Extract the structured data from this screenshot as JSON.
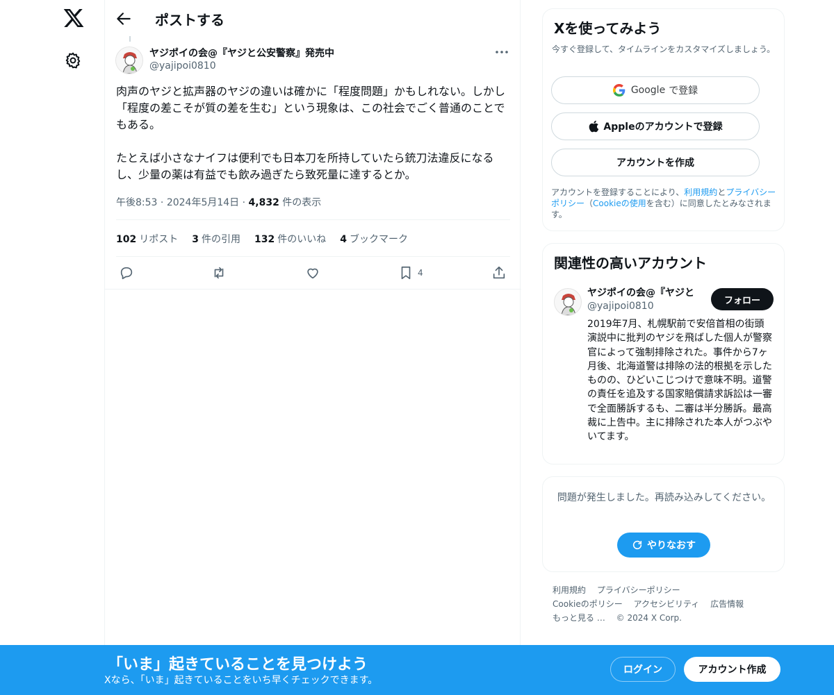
{
  "header": {
    "title": "ポストする"
  },
  "post": {
    "author_name": "ヤジポイの会@『ヤジと公安警察』発売中",
    "author_handle": "@yajipoi0810",
    "text": "肉声のヤジと拡声器のヤジの違いは確かに「程度問題」かもしれない。しかし「程度の差こそが質の差を生む」という現象は、この社会でごく普通のことでもある。\n\nたとえば小さなナイフは便利でも日本刀を所持していたら銃刀法違反になるし、少量の薬は有益でも飲み過ぎたら致死量に達するとか。",
    "time": "午後8:53",
    "date": "2024年5月14日",
    "views_count": "4,832",
    "views_label": "件の表示",
    "stats": {
      "reposts_count": "102",
      "reposts_label": "リポスト",
      "quotes_count": "3",
      "quotes_label": "件の引用",
      "likes_count": "132",
      "likes_label": "件のいいね",
      "bookmarks_count": "4",
      "bookmarks_label": "ブックマーク"
    },
    "bookmark_action_count": "4"
  },
  "signup_card": {
    "title": "Xを使ってみよう",
    "description": "今すぐ登録して、タイムラインをカスタマイズしましょう。",
    "google_brand": "Google",
    "google_suffix": "で登録",
    "apple_label": "Appleのアカウントで登録",
    "create_label": "アカウントを作成",
    "legal_prefix": "アカウントを登録することにより、",
    "legal_terms": "利用規約",
    "legal_and": "と",
    "legal_privacy": "プライバシーポリシー",
    "legal_paren_open": "（",
    "legal_cookie": "Cookieの使用",
    "legal_suffix": "を含む）に同意したとみなされます。"
  },
  "relevant_card": {
    "title": "関連性の高いアカウント",
    "name": "ヤジポイの会@『ヤジと",
    "handle": "@yajipoi0810",
    "follow_label": "フォロー",
    "bio": "2019年7月、札幌駅前で安倍首相の街頭演説中に批判のヤジを飛ばした個人が警察官によって強制排除された。事件から7ヶ月後、北海道警は排除の法的根拠を示したものの、ひどいこじつけで意味不明。道警の責任を追及する国家賠償請求訴訟は一審で全面勝訴するも、二審は半分勝訴。最高裁に上告中。主に排除された本人がつぶやいてます。"
  },
  "error_card": {
    "message": "問題が発生しました。再読み込みしてください。",
    "retry_label": "やりなおす"
  },
  "footer": {
    "terms": "利用規約",
    "privacy": "プライバシーポリシー",
    "cookie": "Cookieのポリシー",
    "accessibility": "アクセシビリティ",
    "ads": "広告情報",
    "more": "もっと見る …",
    "copyright": "© 2024 X Corp."
  },
  "banner": {
    "title": "「いま」起きていることを見つけよう",
    "subtitle": "Xなら、「いま」起きていることをいち早くチェックできます。",
    "login_label": "ログイン",
    "signup_label": "アカウント作成"
  },
  "colors": {
    "accent": "#1d9bf0",
    "text": "#0f1419",
    "muted": "#536471",
    "border": "#eff3f4"
  }
}
